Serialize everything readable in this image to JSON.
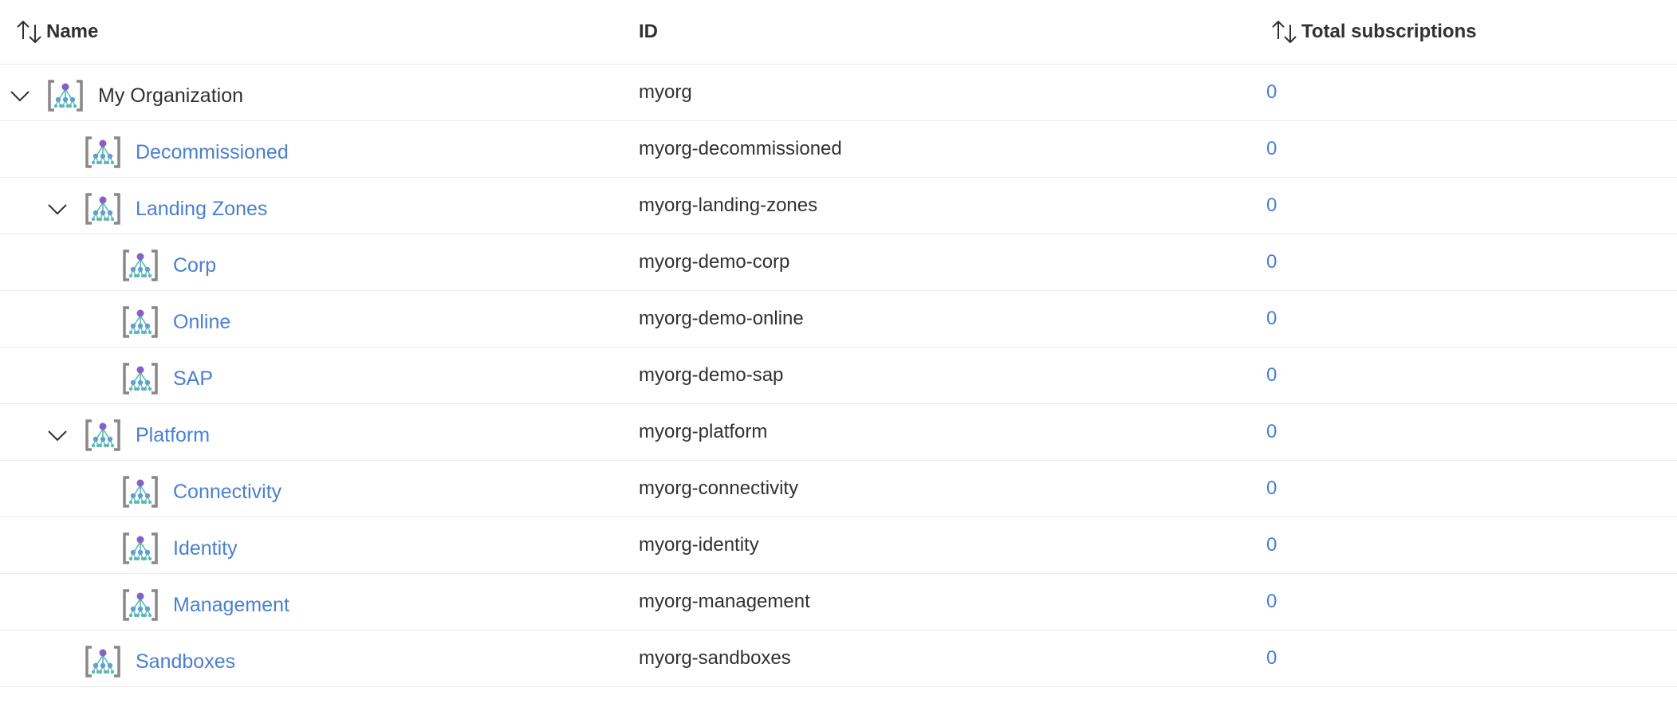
{
  "header": {
    "name_label": "Name",
    "id_label": "ID",
    "total_label": "Total subscriptions"
  },
  "icons": {
    "sort": "sort-arrows-icon",
    "expand": "chevron-down-icon",
    "group": "management-group-icon"
  },
  "colors": {
    "link": "#4a7fd0",
    "text": "#323130",
    "divider": "#edebe9",
    "icon_bracket": "#8a8886",
    "icon_top_node": "#8661c5",
    "icon_child_node": "#5cb8b2"
  },
  "rows": [
    {
      "name": "My Organization",
      "id": "myorg",
      "total": "0",
      "level": 0,
      "expanded": true,
      "link": false
    },
    {
      "name": "Decommissioned",
      "id": "myorg-decommissioned",
      "total": "0",
      "level": 1,
      "expanded": null,
      "link": true
    },
    {
      "name": "Landing Zones",
      "id": "myorg-landing-zones",
      "total": "0",
      "level": 1,
      "expanded": true,
      "link": true
    },
    {
      "name": "Corp",
      "id": "myorg-demo-corp",
      "total": "0",
      "level": 2,
      "expanded": null,
      "link": true
    },
    {
      "name": "Online",
      "id": "myorg-demo-online",
      "total": "0",
      "level": 2,
      "expanded": null,
      "link": true
    },
    {
      "name": "SAP",
      "id": "myorg-demo-sap",
      "total": "0",
      "level": 2,
      "expanded": null,
      "link": true
    },
    {
      "name": "Platform",
      "id": "myorg-platform",
      "total": "0",
      "level": 1,
      "expanded": true,
      "link": true
    },
    {
      "name": "Connectivity",
      "id": "myorg-connectivity",
      "total": "0",
      "level": 2,
      "expanded": null,
      "link": true
    },
    {
      "name": "Identity",
      "id": "myorg-identity",
      "total": "0",
      "level": 2,
      "expanded": null,
      "link": true
    },
    {
      "name": "Management",
      "id": "myorg-management",
      "total": "0",
      "level": 2,
      "expanded": null,
      "link": true
    },
    {
      "name": "Sandboxes",
      "id": "myorg-sandboxes",
      "total": "0",
      "level": 1,
      "expanded": null,
      "link": true
    }
  ]
}
